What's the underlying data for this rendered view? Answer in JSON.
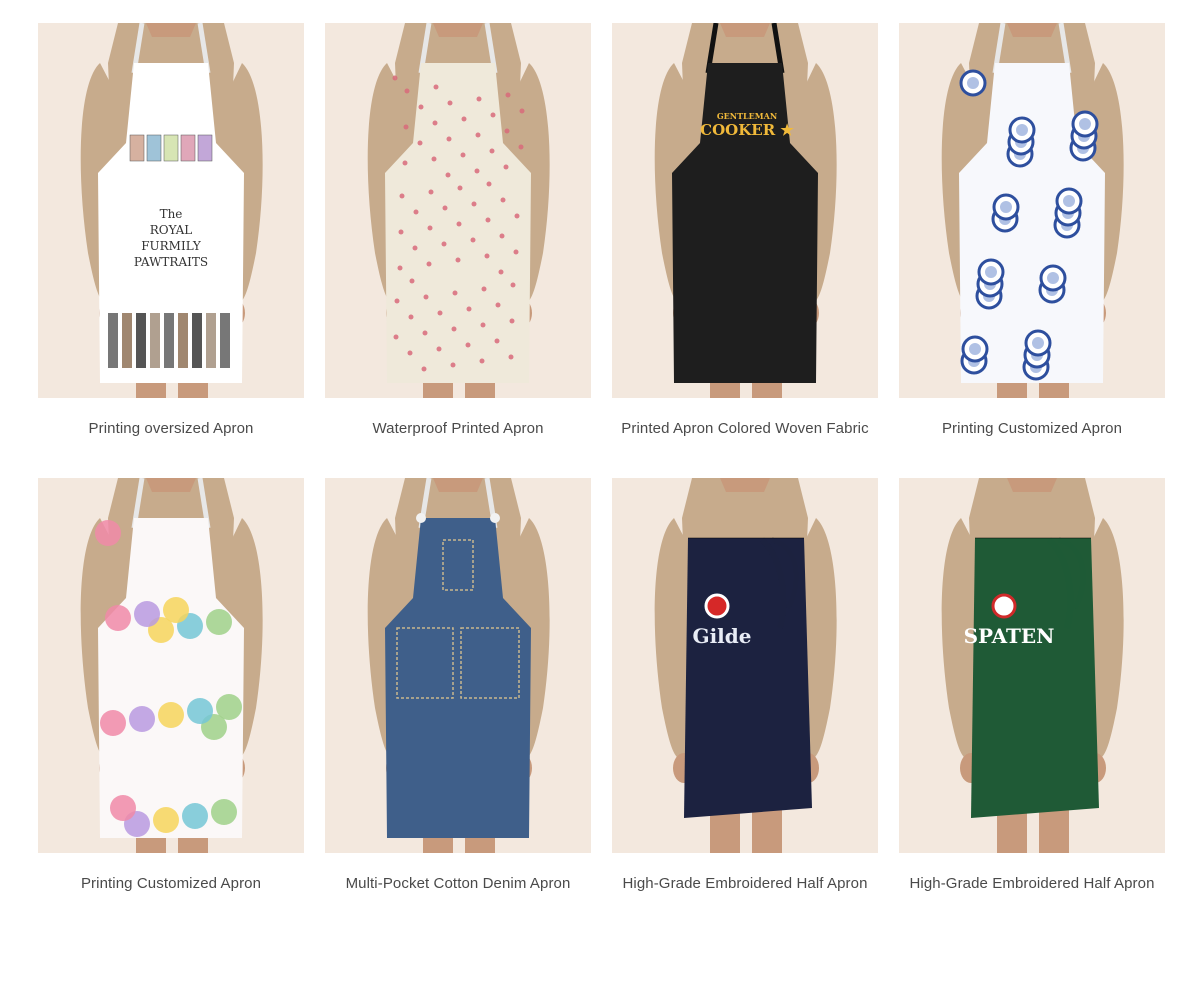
{
  "products": [
    {
      "name": "Printing oversized Apron",
      "apron_color": "#ffffff",
      "accent": "#6f8fb5",
      "style": "full-cat",
      "print_text": [
        "The",
        "ROYAL",
        "FURMILY",
        "PAWTRAITS"
      ]
    },
    {
      "name": "Waterproof Printed Apron",
      "apron_color": "#efe9da",
      "accent": "#d86a7a",
      "style": "full-floral-small",
      "print_text": []
    },
    {
      "name": "Printed Apron Colored Woven Fabric",
      "apron_color": "#1e1e1e",
      "accent": "#f0b93a",
      "style": "full-logo",
      "print_text": [
        "GENTLEMAN",
        "COOKER ★"
      ]
    },
    {
      "name": "Printing Customized Apron",
      "apron_color": "#f7f8fc",
      "accent": "#2e4f9e",
      "style": "full-plates",
      "print_text": []
    },
    {
      "name": "Printing Customized Apron",
      "apron_color": "#fbf8f8",
      "accent": "#f27ea3",
      "style": "full-roses",
      "print_text": []
    },
    {
      "name": "Multi-Pocket Cotton Denim Apron",
      "apron_color": "#3f5f8a",
      "accent": "#c9b78e",
      "style": "full-denim",
      "print_text": []
    },
    {
      "name": "High-Grade Embroidered Half Apron",
      "apron_color": "#1c2240",
      "accent": "#e8ecf5",
      "style": "half-logo",
      "print_text": [
        "Gilde"
      ]
    },
    {
      "name": "High-Grade Embroidered Half Apron",
      "apron_color": "#1f5a36",
      "accent": "#d02a2a",
      "style": "half-logo-green",
      "print_text": [
        "SPATEN"
      ]
    }
  ],
  "colors": {
    "thumb_background": "#f3e8de",
    "sweater": "#c7ab8c",
    "skin": "#c89a7c",
    "caption_text": "#4a4a4a"
  }
}
